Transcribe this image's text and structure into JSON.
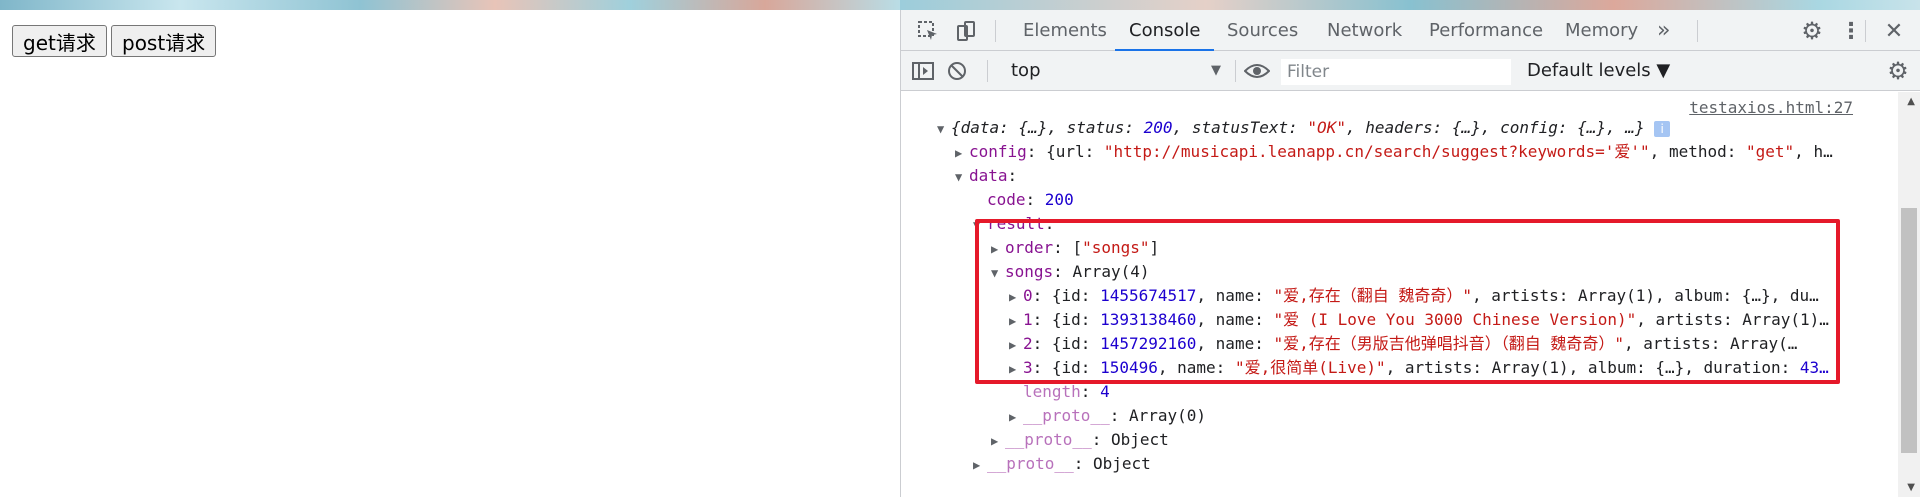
{
  "page": {
    "buttons": [
      "get请求",
      "post请求"
    ]
  },
  "devtools": {
    "tabs": [
      "Elements",
      "Console",
      "Sources",
      "Network",
      "Performance",
      "Memory"
    ],
    "more_tabs": "»",
    "context": "top",
    "filter_placeholder": "Filter",
    "levels": "Default levels ▼"
  },
  "console": {
    "source_link": "testaxios.html:27",
    "lines": [
      {
        "indent": 0,
        "tri": "▼",
        "segments": [
          {
            "t": "{data: {…}, status: ",
            "c": "i"
          },
          {
            "t": "200",
            "c": "i n"
          },
          {
            "t": ", statusText: ",
            "c": "i"
          },
          {
            "t": "\"OK\"",
            "c": "i s"
          },
          {
            "t": ", headers: {…}, config: {…}, …} ",
            "c": "i"
          }
        ],
        "info": "i"
      },
      {
        "indent": 1,
        "tri": "▶",
        "segments": [
          {
            "t": "config",
            "c": "k"
          },
          {
            "t": ": {url: ",
            "c": ""
          },
          {
            "t": "\"http://musicapi.leanapp.cn/search/suggest?keywords='爱'\"",
            "c": "s"
          },
          {
            "t": ", method: ",
            "c": ""
          },
          {
            "t": "\"get\"",
            "c": "s"
          },
          {
            "t": ", h…",
            "c": ""
          }
        ]
      },
      {
        "indent": 1,
        "tri": "▼",
        "segments": [
          {
            "t": "data",
            "c": "k"
          },
          {
            "t": ":",
            "c": ""
          }
        ]
      },
      {
        "indent": 2,
        "tri": "",
        "segments": [
          {
            "t": "code",
            "c": "k"
          },
          {
            "t": ": ",
            "c": ""
          },
          {
            "t": "200",
            "c": "n"
          }
        ]
      },
      {
        "indent": 2,
        "tri": "▼",
        "segments": [
          {
            "t": "result",
            "c": "k"
          },
          {
            "t": ":",
            "c": ""
          }
        ]
      },
      {
        "indent": 3,
        "tri": "▶",
        "segments": [
          {
            "t": "order",
            "c": "k"
          },
          {
            "t": ": [",
            "c": ""
          },
          {
            "t": "\"songs\"",
            "c": "s"
          },
          {
            "t": "]",
            "c": ""
          }
        ]
      },
      {
        "indent": 3,
        "tri": "▼",
        "segments": [
          {
            "t": "songs",
            "c": "k"
          },
          {
            "t": ": Array(4)",
            "c": ""
          }
        ]
      },
      {
        "indent": 4,
        "tri": "▶",
        "segments": [
          {
            "t": "0",
            "c": "k"
          },
          {
            "t": ": {id: ",
            "c": ""
          },
          {
            "t": "1455674517",
            "c": "n"
          },
          {
            "t": ", name: ",
            "c": ""
          },
          {
            "t": "\"爱,存在（翻自 魏奇奇）\"",
            "c": "s"
          },
          {
            "t": ", artists: Array(1), album: {…}, du…",
            "c": ""
          }
        ]
      },
      {
        "indent": 4,
        "tri": "▶",
        "segments": [
          {
            "t": "1",
            "c": "k"
          },
          {
            "t": ": {id: ",
            "c": ""
          },
          {
            "t": "1393138460",
            "c": "n"
          },
          {
            "t": ", name: ",
            "c": ""
          },
          {
            "t": "\"爱 (I Love You 3000 Chinese Version)\"",
            "c": "s"
          },
          {
            "t": ", artists: Array(1)…",
            "c": ""
          }
        ]
      },
      {
        "indent": 4,
        "tri": "▶",
        "segments": [
          {
            "t": "2",
            "c": "k"
          },
          {
            "t": ": {id: ",
            "c": ""
          },
          {
            "t": "1457292160",
            "c": "n"
          },
          {
            "t": ", name: ",
            "c": ""
          },
          {
            "t": "\"爱,存在（男版吉他弹唱抖音）（翻自 魏奇奇）\"",
            "c": "s"
          },
          {
            "t": ", artists: Array(…",
            "c": ""
          }
        ]
      },
      {
        "indent": 4,
        "tri": "▶",
        "segments": [
          {
            "t": "3",
            "c": "k"
          },
          {
            "t": ": {id: ",
            "c": ""
          },
          {
            "t": "150496",
            "c": "n"
          },
          {
            "t": ", name: ",
            "c": ""
          },
          {
            "t": "\"爱,很简单(Live)\"",
            "c": "s"
          },
          {
            "t": ", artists: Array(1), album: {…}, duration: ",
            "c": ""
          },
          {
            "t": "43…",
            "c": "n"
          }
        ]
      },
      {
        "indent": 4,
        "tri": "",
        "segments": [
          {
            "t": "length",
            "c": "ks"
          },
          {
            "t": ": ",
            "c": ""
          },
          {
            "t": "4",
            "c": "n"
          }
        ]
      },
      {
        "indent": 4,
        "tri": "▶",
        "segments": [
          {
            "t": "__proto__",
            "c": "ks"
          },
          {
            "t": ": Array(0)",
            "c": ""
          }
        ]
      },
      {
        "indent": 3,
        "tri": "▶",
        "segments": [
          {
            "t": "__proto__",
            "c": "ks"
          },
          {
            "t": ": Object",
            "c": ""
          }
        ]
      },
      {
        "indent": 2,
        "tri": "▶",
        "segments": [
          {
            "t": "__proto__",
            "c": "ks"
          },
          {
            "t": ": Object",
            "c": ""
          }
        ]
      }
    ]
  }
}
